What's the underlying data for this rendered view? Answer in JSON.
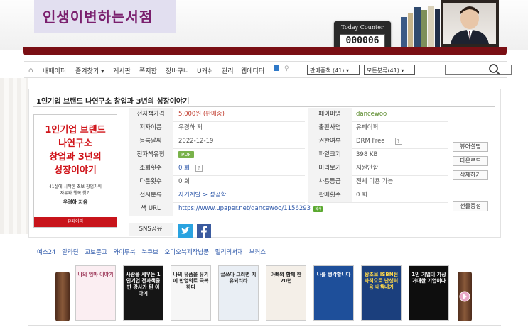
{
  "header": {
    "site_title": "인생이변하는서점",
    "counter_label": "Today Counter",
    "counter_value": "000006"
  },
  "nav": {
    "items": [
      "내페이퍼",
      "즐겨찾기",
      "게시판",
      "쪽지함",
      "장바구니",
      "U캐쉬",
      "관리",
      "웹에디터"
    ],
    "select_sort": "판매중책 (41)",
    "select_category": "모든분류(41)",
    "search_placeholder": ""
  },
  "book": {
    "title": "1인기업 브랜드 나연구소 창업과 3년의 성장이야기",
    "cover": {
      "line1": "1인기업 브랜드",
      "line2": "나연구소",
      "line3": "창업과 3년의",
      "line4": "성장이야기",
      "sub1": "41살에 시작한 초보 창업가의",
      "sub2": "자유와 행복 찾기",
      "author": "우경하 지음",
      "publisher": "유페이퍼"
    },
    "fields_left": [
      {
        "label": "전자책가격",
        "value": "5,000원 (판매중)"
      },
      {
        "label": "저자이름",
        "value": "우경하 저"
      },
      {
        "label": "등록날짜",
        "value": "2022-12-19"
      },
      {
        "label": "전자책유형",
        "value": "PDF"
      },
      {
        "label": "조회횟수",
        "value": "0 회"
      },
      {
        "label": "다운횟수",
        "value": "0 회"
      },
      {
        "label": "전시분류",
        "value": "자기계발 > 성공학"
      },
      {
        "label": "책 URL",
        "value": "https://www.upaper.net/dancewoo/1156293"
      },
      {
        "label": "SNS공유",
        "value": ""
      }
    ],
    "fields_right": [
      {
        "label": "페이퍼명",
        "value": "dancewoo"
      },
      {
        "label": "출판사명",
        "value": "유페이퍼"
      },
      {
        "label": "권한여부",
        "value": "DRM Free"
      },
      {
        "label": "파일크기",
        "value": "398 KB"
      },
      {
        "label": "미리보기",
        "value": "지원안함"
      },
      {
        "label": "사용등급",
        "value": "전체 이용 가능"
      },
      {
        "label": "판매횟수",
        "value": "0 회"
      }
    ],
    "question_mark": "?",
    "url_badge": "복사"
  },
  "side_buttons": [
    "뷰어설명",
    "다운로드",
    "삭제하기",
    "선물증정"
  ],
  "store_links": [
    "예스24",
    "알라딘",
    "교보문고",
    "와이투북",
    "북큐브",
    "오디오북제작납품",
    "밀리의서재",
    "부커스"
  ],
  "thumbnails": [
    {
      "title": "나의 엄마 이야기",
      "bg": "#fbeef2",
      "fg": "#9a3355"
    },
    {
      "title": "사람을 세우는 1인기업 전자책출판 강사가 된 이야기",
      "bg": "#151515",
      "fg": "#ffffff"
    },
    {
      "title": "나의 유품을 유기에 만엉의로 극복하다",
      "bg": "#f6f6f6",
      "fg": "#222222"
    },
    {
      "title": "글쓰다 그러면 치유되리라",
      "bg": "#e9eef4",
      "fg": "#333333"
    },
    {
      "title": "아빠와 함께 한 20년",
      "bg": "#f4efe8",
      "fg": "#222222"
    },
    {
      "title": "나를 생각합니다",
      "bg": "#1e4f9a",
      "fg": "#ffffff"
    },
    {
      "title": "왕초보 ISBN전자책으로 난생처음 내책내기",
      "bg": "#1b3f7d",
      "fg": "#ffd84a"
    },
    {
      "title": "1인 기업이 가장 거대한 기업이다",
      "bg": "#0e0e0e",
      "fg": "#ffffff"
    }
  ],
  "colors": {
    "brand": "#7a1f6e",
    "shelf": "#7a0f14",
    "price": "#c0392b",
    "link": "#2a55a8",
    "pdf": "#79b24a"
  }
}
